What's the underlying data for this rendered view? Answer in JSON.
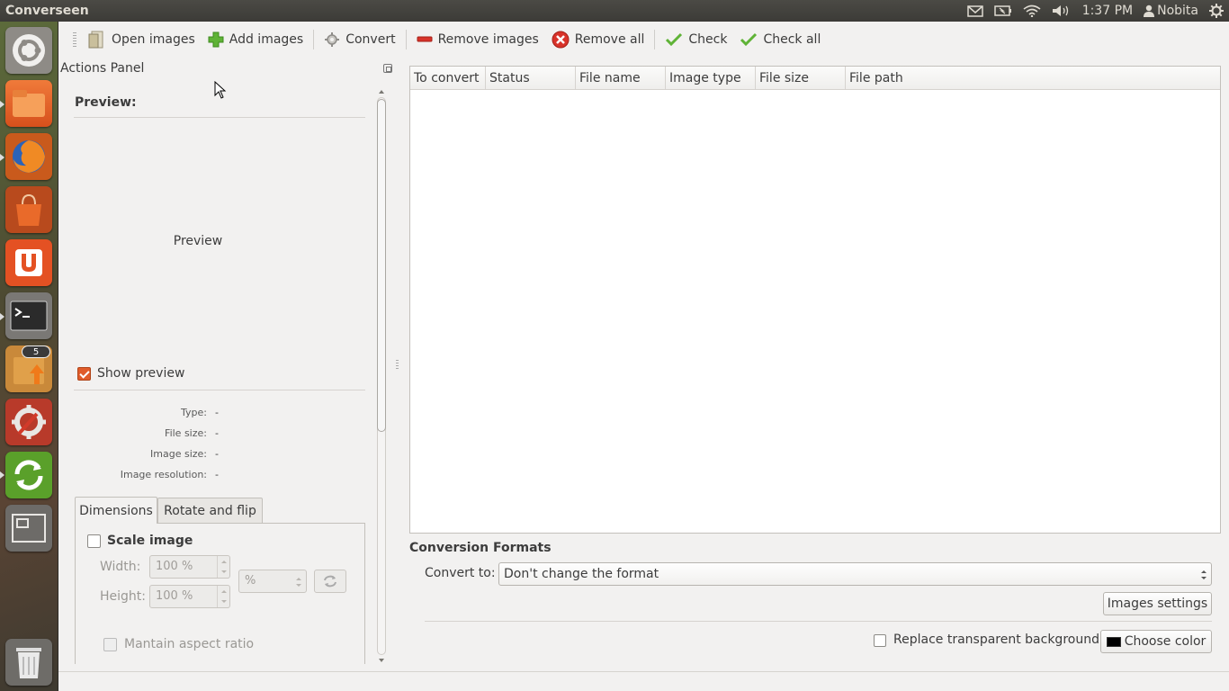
{
  "top_panel": {
    "app_title": "Converseen",
    "time": "1:37 PM",
    "user": "Nobita",
    "icons": [
      "mail-icon",
      "battery-icon",
      "wifi-icon",
      "volume-icon",
      "user-icon",
      "gear-icon"
    ]
  },
  "launcher": {
    "items": [
      "ubuntu-dash-icon",
      "files-icon",
      "firefox-icon",
      "software-center-icon",
      "ubuntu-one-icon",
      "terminal-icon",
      "software-updater-icon",
      "system-settings-icon",
      "converseen-icon",
      "workspace-switcher-icon",
      "trash-icon"
    ],
    "updater_badge": "5"
  },
  "toolbar": {
    "open_images": "Open images",
    "add_images": "Add images",
    "convert": "Convert",
    "remove_images": "Remove images",
    "remove_all": "Remove all",
    "check": "Check",
    "check_all": "Check all"
  },
  "actions_panel": {
    "title": "Actions Panel",
    "preview_label": "Preview:",
    "preview_placeholder": "Preview",
    "show_preview": "Show preview",
    "show_preview_checked": true,
    "info": [
      {
        "label": "Type:",
        "value": "-"
      },
      {
        "label": "File size:",
        "value": "-"
      },
      {
        "label": "Image size:",
        "value": "-"
      },
      {
        "label": "Image resolution:",
        "value": "-"
      }
    ],
    "tabs": [
      "Dimensions",
      "Rotate and flip"
    ],
    "active_tab": "Dimensions",
    "dimensions": {
      "scale_image": "Scale image",
      "width_label": "Width:",
      "width_value": "100 %",
      "height_label": "Height:",
      "height_value": "100 %",
      "unit": "%",
      "maintain_aspect": "Mantain aspect ratio"
    }
  },
  "files_table": {
    "columns": [
      "To convert",
      "Status",
      "File name",
      "Image type",
      "File size",
      "File path"
    ],
    "rows": []
  },
  "conversion": {
    "title": "Conversion Formats",
    "convert_to_label": "Convert to:",
    "convert_to_value": "Don't change the format",
    "images_settings": "Images settings",
    "replace_transparent": "Replace transparent background",
    "choose_color": "Choose color",
    "color": "#000000"
  },
  "colors": {
    "accent": "#e05c2a",
    "panel_bg": "#3c3b37",
    "window_bg": "#f2f1f0"
  }
}
